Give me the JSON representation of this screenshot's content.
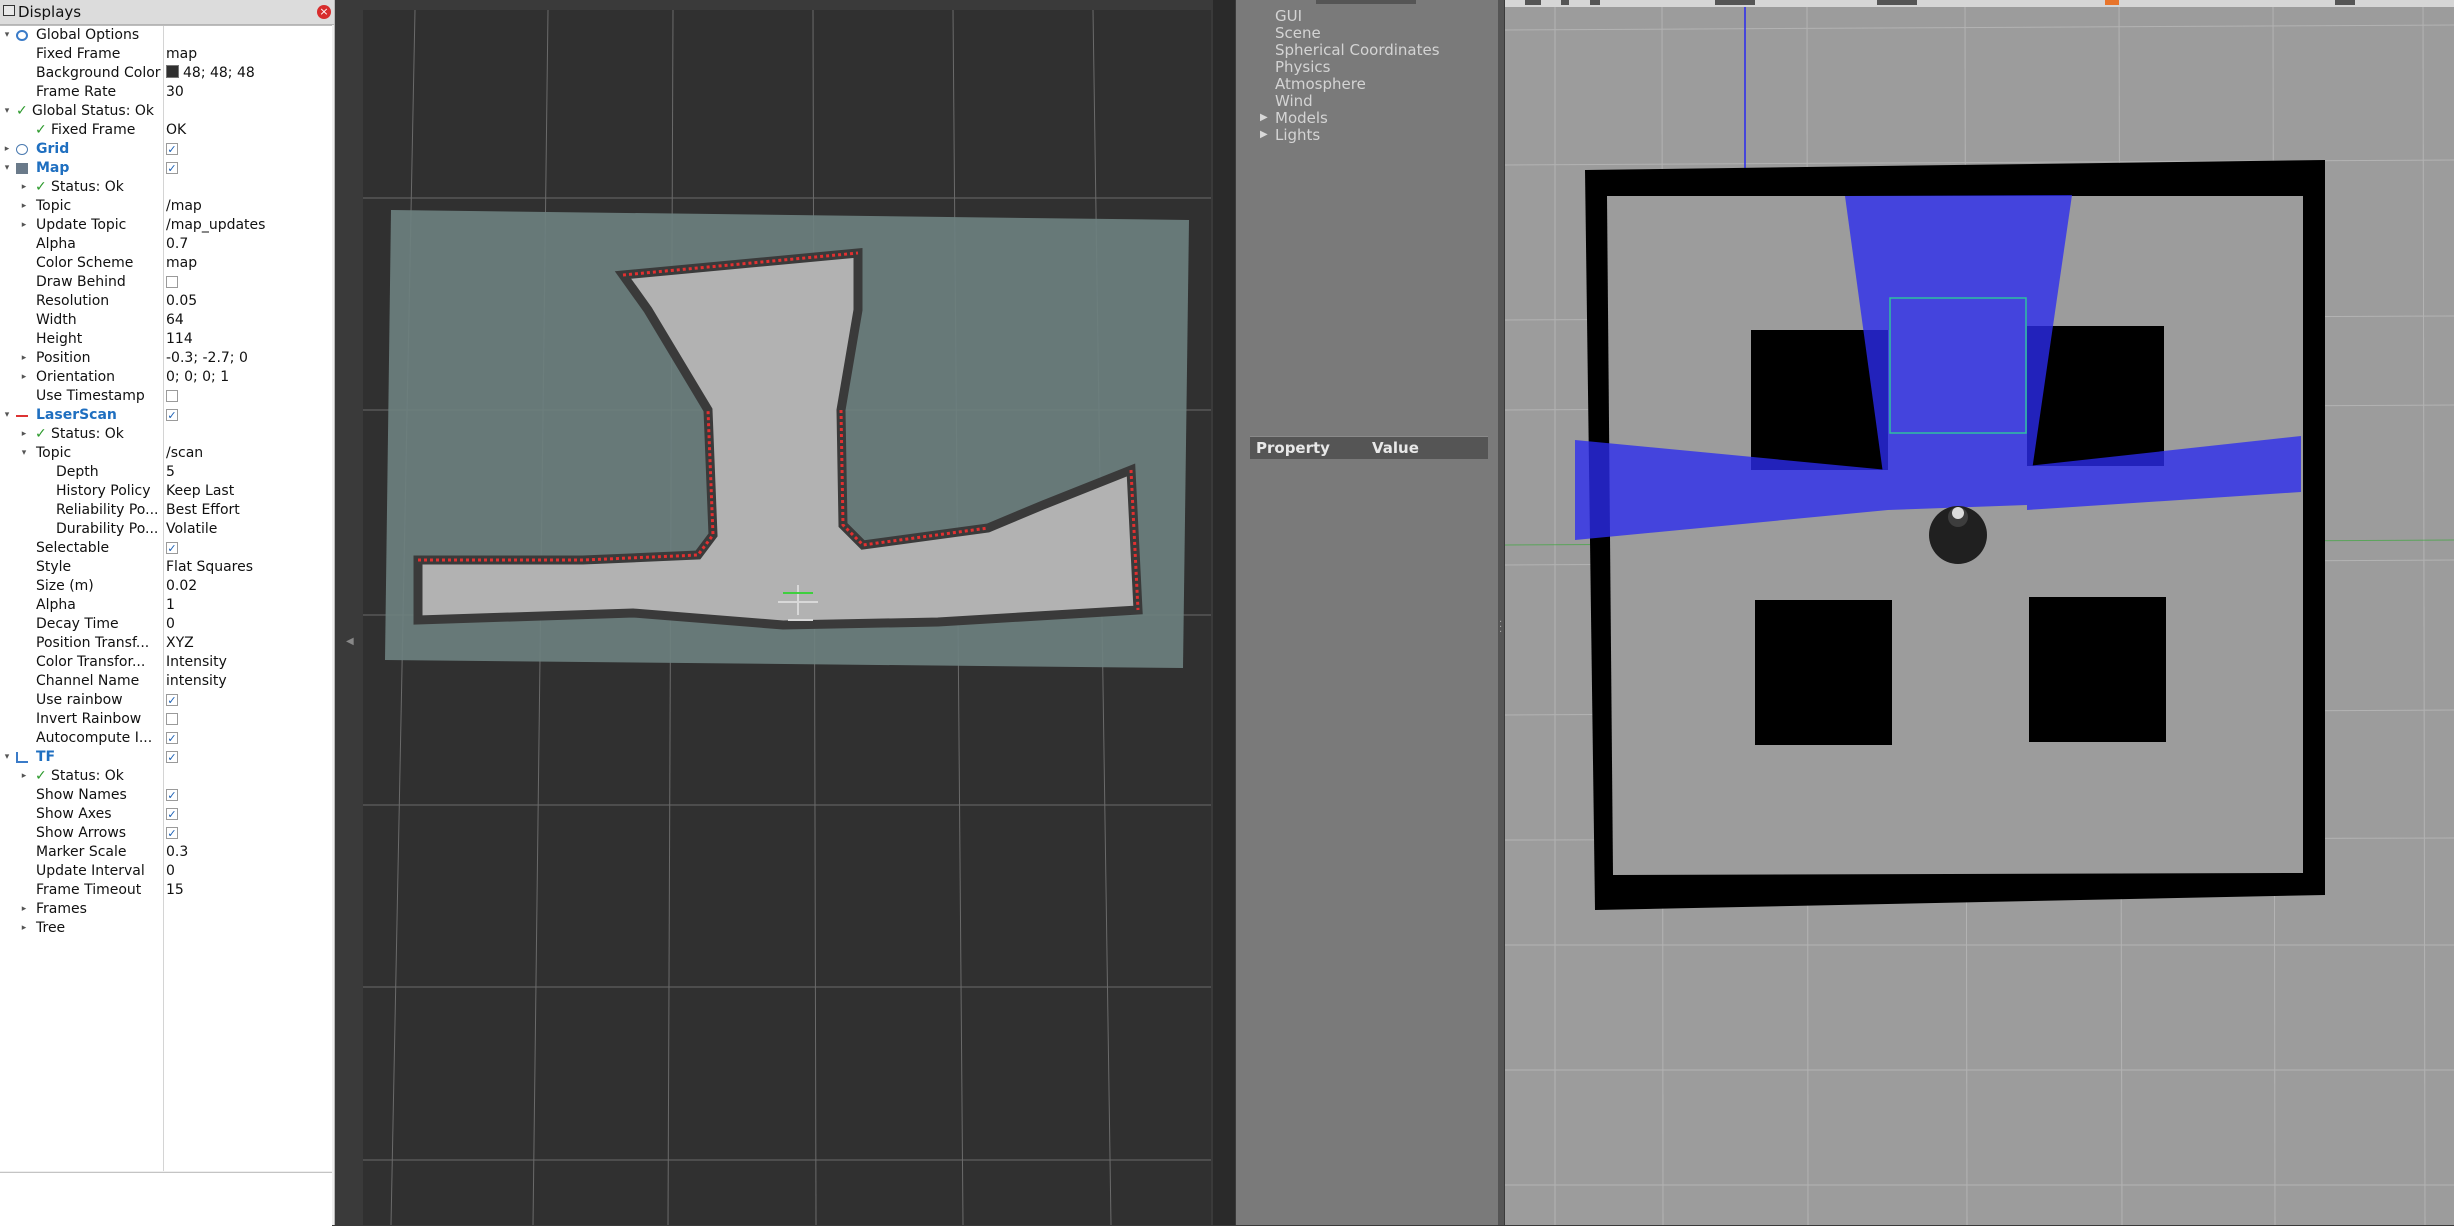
{
  "rviz": {
    "panel_title": "Displays",
    "rows": [
      {
        "name": "Global Options",
        "indent": 0,
        "expander": "open",
        "icon": "gear-icon"
      },
      {
        "name": "Fixed Frame",
        "value": "map",
        "indent": 1
      },
      {
        "name": "Background Color",
        "value": "48; 48; 48",
        "indent": 1,
        "swatch": "#303030"
      },
      {
        "name": "Frame Rate",
        "value": "30",
        "indent": 1
      },
      {
        "name": "Global Status: Ok",
        "indent": 0,
        "expander": "open",
        "check": true
      },
      {
        "name": "Fixed Frame",
        "value": "OK",
        "indent": 1,
        "check": true
      },
      {
        "name": "Grid",
        "indent": 0,
        "expander": "closed",
        "icon": "grid-icon",
        "blue": true,
        "checkbox": true
      },
      {
        "name": "Map",
        "indent": 0,
        "expander": "open",
        "icon": "map-icon",
        "blue": true,
        "checkbox": true
      },
      {
        "name": "Status: Ok",
        "indent": 1,
        "expander": "closed",
        "check": true
      },
      {
        "name": "Topic",
        "value": "/map",
        "indent": 1,
        "expander": "closed"
      },
      {
        "name": "Update Topic",
        "value": "/map_updates",
        "indent": 1,
        "expander": "closed"
      },
      {
        "name": "Alpha",
        "value": "0.7",
        "indent": 1
      },
      {
        "name": "Color Scheme",
        "value": "map",
        "indent": 1
      },
      {
        "name": "Draw Behind",
        "indent": 1,
        "checkbox": false
      },
      {
        "name": "Resolution",
        "value": "0.05",
        "indent": 1
      },
      {
        "name": "Width",
        "value": "64",
        "indent": 1
      },
      {
        "name": "Height",
        "value": "114",
        "indent": 1
      },
      {
        "name": "Position",
        "value": "-0.3; -2.7; 0",
        "indent": 1,
        "expander": "closed"
      },
      {
        "name": "Orientation",
        "value": "0; 0; 0; 1",
        "indent": 1,
        "expander": "closed"
      },
      {
        "name": "Use Timestamp",
        "indent": 1,
        "checkbox": false
      },
      {
        "name": "LaserScan",
        "indent": 0,
        "expander": "open",
        "icon": "laserscan-icon",
        "blue": true,
        "checkbox": true
      },
      {
        "name": "Status: Ok",
        "indent": 1,
        "expander": "closed",
        "check": true
      },
      {
        "name": "Topic",
        "value": "/scan",
        "indent": 1,
        "expander": "open"
      },
      {
        "name": "Depth",
        "value": "5",
        "indent": 2
      },
      {
        "name": "History Policy",
        "value": "Keep Last",
        "indent": 2
      },
      {
        "name": "Reliability Po...",
        "value": "Best Effort",
        "indent": 2
      },
      {
        "name": "Durability Po...",
        "value": "Volatile",
        "indent": 2
      },
      {
        "name": "Selectable",
        "indent": 1,
        "checkbox": true
      },
      {
        "name": "Style",
        "value": "Flat Squares",
        "indent": 1
      },
      {
        "name": "Size (m)",
        "value": "0.02",
        "indent": 1
      },
      {
        "name": "Alpha",
        "value": "1",
        "indent": 1
      },
      {
        "name": "Decay Time",
        "value": "0",
        "indent": 1
      },
      {
        "name": "Position Transf...",
        "value": "XYZ",
        "indent": 1
      },
      {
        "name": "Color Transfor...",
        "value": "Intensity",
        "indent": 1
      },
      {
        "name": "Channel Name",
        "value": "intensity",
        "indent": 1
      },
      {
        "name": "Use rainbow",
        "indent": 1,
        "checkbox": true
      },
      {
        "name": "Invert Rainbow",
        "indent": 1,
        "checkbox": false
      },
      {
        "name": "Autocompute I...",
        "indent": 1,
        "checkbox": true
      },
      {
        "name": "TF",
        "indent": 0,
        "expander": "open",
        "icon": "tf-icon",
        "blue": true,
        "checkbox": true
      },
      {
        "name": "Status: Ok",
        "indent": 1,
        "expander": "closed",
        "check": true
      },
      {
        "name": "Show Names",
        "indent": 1,
        "checkbox": true
      },
      {
        "name": "Show Axes",
        "indent": 1,
        "checkbox": true
      },
      {
        "name": "Show Arrows",
        "indent": 1,
        "checkbox": true
      },
      {
        "name": "Marker Scale",
        "value": "0.3",
        "indent": 1
      },
      {
        "name": "Update Interval",
        "value": "0",
        "indent": 1
      },
      {
        "name": "Frame Timeout",
        "value": "15",
        "indent": 1
      },
      {
        "name": "Frames",
        "indent": 1,
        "expander": "closed"
      },
      {
        "name": "Tree",
        "indent": 1,
        "expander": "closed"
      }
    ]
  },
  "gazebo": {
    "world_items": [
      {
        "label": "GUI"
      },
      {
        "label": "Scene"
      },
      {
        "label": "Spherical Coordinates"
      },
      {
        "label": "Physics"
      },
      {
        "label": "Atmosphere"
      },
      {
        "label": "Wind"
      },
      {
        "label": "Models",
        "expander": true
      },
      {
        "label": "Lights",
        "expander": true
      }
    ],
    "property_header": {
      "property": "Property",
      "value": "Value"
    }
  }
}
